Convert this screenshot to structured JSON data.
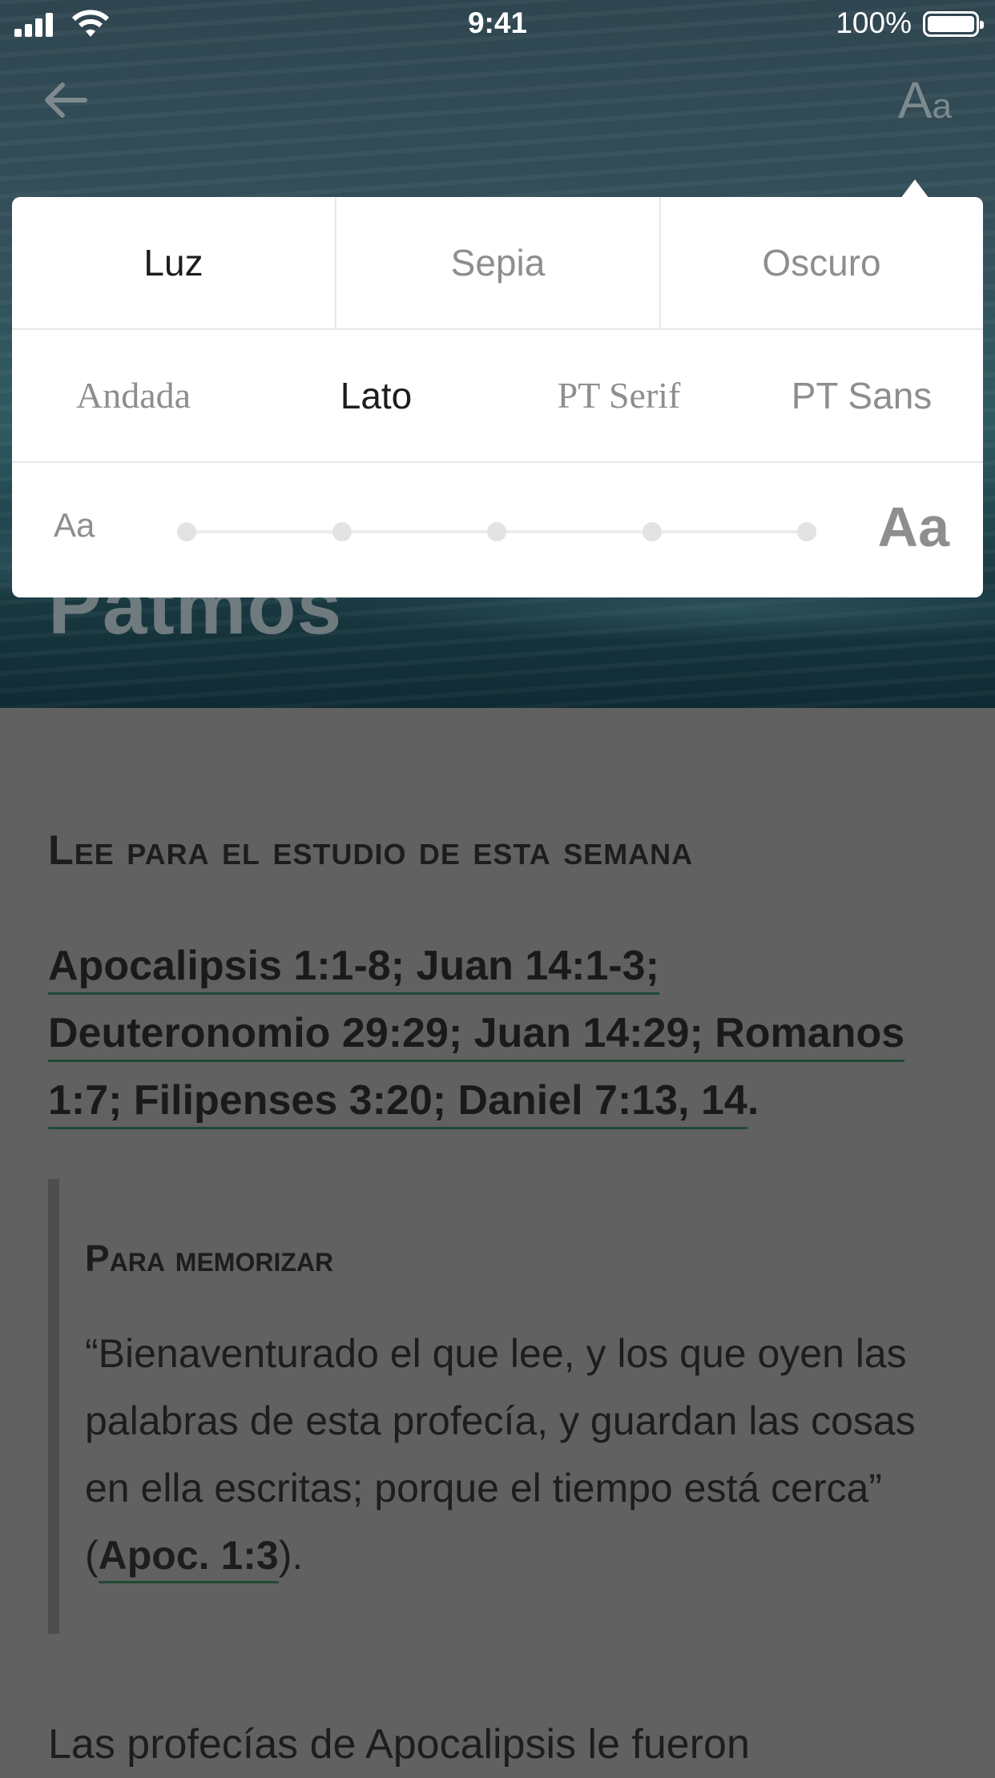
{
  "status_bar": {
    "time": "9:41",
    "battery_percent": "100%"
  },
  "header": {
    "title_partial": "Patmos",
    "font_button_big": "A",
    "font_button_small": "a"
  },
  "popup": {
    "themes": [
      {
        "label": "Luz",
        "selected": true
      },
      {
        "label": "Sepia",
        "selected": false
      },
      {
        "label": "Oscuro",
        "selected": false
      }
    ],
    "fonts": [
      {
        "label": "Andada",
        "selected": false
      },
      {
        "label": "Lato",
        "selected": true
      },
      {
        "label": "PT Serif",
        "selected": false
      },
      {
        "label": "PT Sans",
        "selected": false
      }
    ],
    "size_small_label": "Aa",
    "size_large_label": "Aa",
    "size_steps": 5
  },
  "article": {
    "section_heading": "Lee para el estudio de esta semana",
    "refs": [
      "Apocalipsis 1:1-8; Juan 14:1-3;",
      "Deuteronomio 29:29; Juan 14:29; Romanos",
      "1:7; Filipenses 3:20; Daniel 7:13, 14"
    ],
    "refs_trailing": ".",
    "memory_title": "Para memorizar",
    "memory_text": "“Bienaventurado el que lee, y los que oyen las palabras de esta profecía, y guardan las cosas en ella escritas; porque el tiempo está cerca” (",
    "memory_ref": "Apoc. 1:3",
    "memory_tail": ").",
    "body_start": "Las profecías de Apocalipsis le fueron"
  }
}
